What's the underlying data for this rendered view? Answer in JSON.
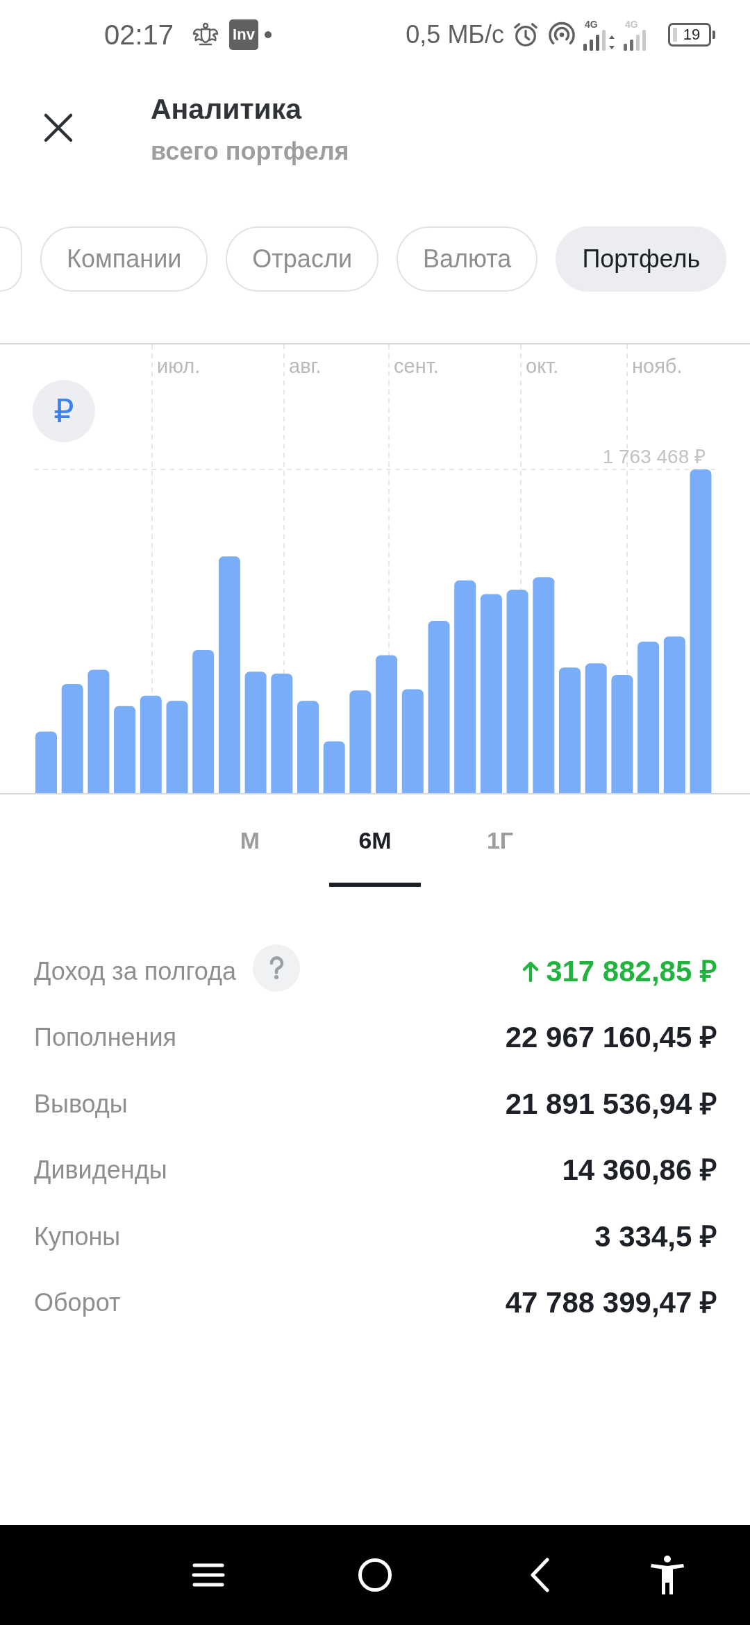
{
  "status_bar": {
    "time": "02:17",
    "app_badge": "Inv",
    "speed": "0,5 МБ/с",
    "sims": [
      {
        "network": "4G",
        "active": true
      },
      {
        "network": "4G",
        "active": false
      }
    ],
    "battery": "19"
  },
  "header": {
    "title": "Аналитика",
    "subtitle": "всего портфеля"
  },
  "filter_chips": [
    {
      "label": "Компании",
      "selected": false
    },
    {
      "label": "Отрасли",
      "selected": false
    },
    {
      "label": "Валюта",
      "selected": false
    },
    {
      "label": "Портфель",
      "selected": true
    }
  ],
  "chart": {
    "currency": "₽",
    "months": [
      "июл.",
      "авг.",
      "сент.",
      "окт.",
      "нояб."
    ],
    "max_label": "1 763 468 ₽"
  },
  "periods": [
    {
      "label": "М",
      "selected": false
    },
    {
      "label": "6М",
      "selected": true
    },
    {
      "label": "1Г",
      "selected": false
    }
  ],
  "stats": [
    {
      "kind": "gain",
      "label": "Доход за полгода",
      "value": "317 882,85 ₽"
    },
    {
      "kind": "amount",
      "label": "Пополнения",
      "value": "22 967 160,45 ₽"
    },
    {
      "kind": "amount",
      "label": "Выводы",
      "value": "21 891 536,94 ₽"
    },
    {
      "kind": "amount",
      "label": "Дивиденды",
      "value": "14 360,86 ₽"
    },
    {
      "kind": "amount",
      "label": "Купоны",
      "value": "3 334,5 ₽"
    },
    {
      "kind": "amount",
      "label": "Оборот",
      "value": "47 788 399,47 ₽"
    }
  ]
}
